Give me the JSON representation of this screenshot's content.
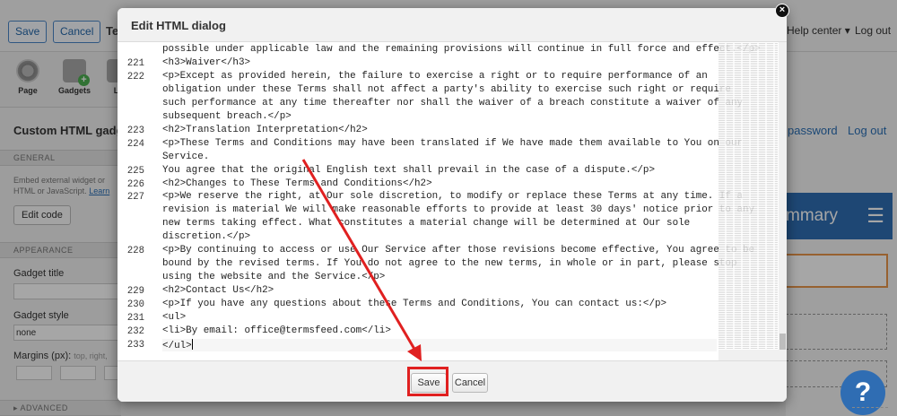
{
  "app": {
    "save_label": "Save",
    "cancel_label": "Cancel",
    "title_fragment": "Te",
    "help_center": "Help center ▾",
    "logout": "Log out"
  },
  "toolbar": {
    "items": [
      {
        "label": "Page",
        "icon": "gear-icon"
      },
      {
        "label": "Gadgets",
        "icon": "add-gadget-icon"
      },
      {
        "label": "La",
        "icon": "layout-icon"
      }
    ]
  },
  "panel": {
    "title": "Custom HTML gadg",
    "general_section": "GENERAL",
    "description_line1": "Embed external widget or",
    "description_line2": "HTML or JavaScript.",
    "description_link": "Learn",
    "edit_code_button": "Edit code",
    "appearance_section": "APPEARANCE",
    "gadget_title_label": "Gadget title",
    "gadget_style_label": "Gadget style",
    "gadget_style_value": "none",
    "margins_label": "Margins (px):",
    "margins_hint": "top, right,",
    "advanced_section": "▸ ADVANCED"
  },
  "right_side": {
    "password_link": "password",
    "logout_link": "Log out",
    "banner_text": "mmary",
    "menu_icon": "hamburger-icon",
    "help_glyph": "?",
    "accent_color": "#2f6db3",
    "orange_border_color": "#e9964a"
  },
  "dialog": {
    "title": "Edit HTML dialog",
    "close_glyph": "×",
    "save_label": "Save",
    "cancel_label": "Cancel",
    "highlight_color": "#e02020",
    "lines": [
      {
        "num": "",
        "text": "possible under applicable law and the remaining provisions will continue in full force and effect.</p>"
      },
      {
        "num": "221",
        "text": "<h3>Waiver</h3>"
      },
      {
        "num": "222",
        "text": "<p>Except as provided herein, the failure to exercise a right or to require performance of an"
      },
      {
        "num": "",
        "text": "obligation under these Terms shall not affect a party's ability to exercise such right or require"
      },
      {
        "num": "",
        "text": "such performance at any time thereafter nor shall the waiver of a breach constitute a waiver of any"
      },
      {
        "num": "",
        "text": "subsequent breach.</p>"
      },
      {
        "num": "223",
        "text": "<h2>Translation Interpretation</h2>"
      },
      {
        "num": "224",
        "text": "<p>These Terms and Conditions may have been translated if We have made them available to You on our"
      },
      {
        "num": "",
        "text": "Service."
      },
      {
        "num": "225",
        "text": "You agree that the original English text shall prevail in the case of a dispute.</p>"
      },
      {
        "num": "226",
        "text": "<h2>Changes to These Terms and Conditions</h2>"
      },
      {
        "num": "227",
        "text": "<p>We reserve the right, at Our sole discretion, to modify or replace these Terms at any time. If a"
      },
      {
        "num": "",
        "text": "revision is material We will make reasonable efforts to provide at least 30 days' notice prior to any"
      },
      {
        "num": "",
        "text": "new terms taking effect. What constitutes a material change will be determined at Our sole"
      },
      {
        "num": "",
        "text": "discretion.</p>"
      },
      {
        "num": "228",
        "text": "<p>By continuing to access or use Our Service after those revisions become effective, You agree to be"
      },
      {
        "num": "",
        "text": "bound by the revised terms. If You do not agree to the new terms, in whole or in part, please stop"
      },
      {
        "num": "",
        "text": "using the website and the Service.</p>"
      },
      {
        "num": "229",
        "text": "<h2>Contact Us</h2>"
      },
      {
        "num": "230",
        "text": "<p>If you have any questions about these Terms and Conditions, You can contact us:</p>"
      },
      {
        "num": "231",
        "text": "<ul>"
      },
      {
        "num": "232",
        "text": "<li>By email: office@termsfeed.com</li>"
      },
      {
        "num": "233",
        "text": "</ul>"
      }
    ]
  }
}
